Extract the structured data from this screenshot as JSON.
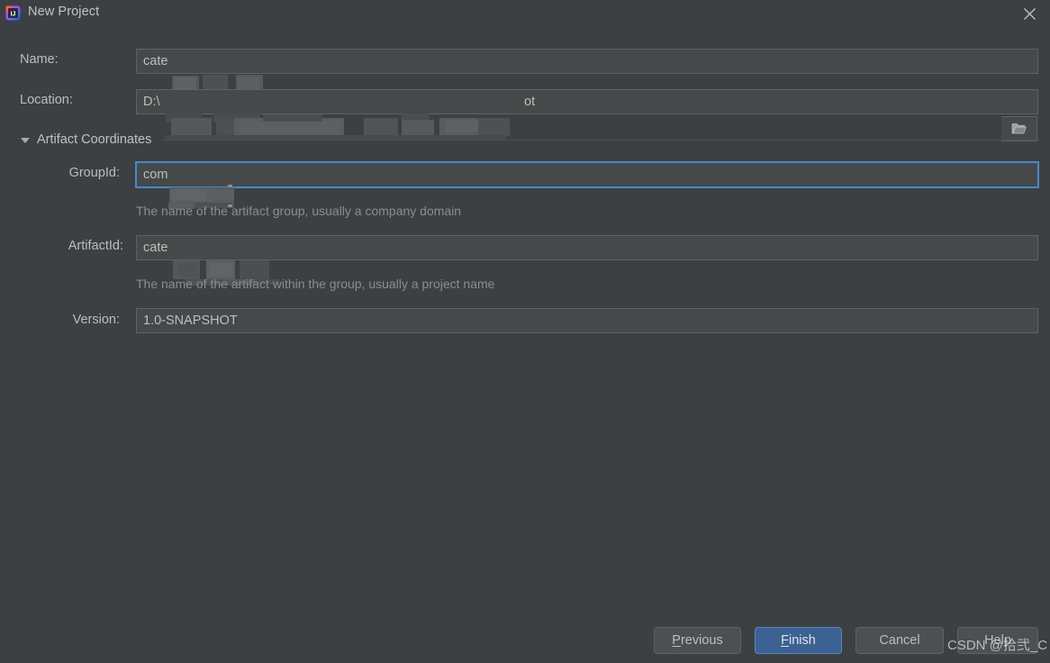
{
  "window": {
    "title": "New Project",
    "app_icon": "intellij-idea-icon",
    "close_icon": "close-icon",
    "background_color": "#3c4043"
  },
  "form": {
    "name": {
      "label": "Name:",
      "value": "cate",
      "redacted": true
    },
    "location": {
      "label": "Location:",
      "value": "D:\\",
      "value_tail": "ot",
      "redacted": true,
      "browse_icon": "folder-open-icon"
    }
  },
  "section": {
    "title": "Artifact Coordinates",
    "expanded": true,
    "twisty_icon": "chevron-down-icon",
    "fields": {
      "group_id": {
        "label": "GroupId:",
        "value": "com",
        "redacted": true,
        "focused": true,
        "hint": "The name of the artifact group, usually a company domain"
      },
      "artifact_id": {
        "label": "ArtifactId:",
        "value": "cate",
        "redacted": true,
        "focused": false,
        "hint": "The name of the artifact within the group, usually a project name"
      },
      "version": {
        "label": "Version:",
        "value": "1.0-SNAPSHOT",
        "redacted": false,
        "focused": false
      }
    }
  },
  "buttons": {
    "previous": {
      "label_prefix": "",
      "mnemonic": "P",
      "label_suffix": "revious",
      "primary": false
    },
    "finish": {
      "label_prefix": "",
      "mnemonic": "F",
      "label_suffix": "inish",
      "primary": true
    },
    "cancel": {
      "label": "Cancel",
      "primary": false
    },
    "help": {
      "label": "Help",
      "primary": false
    }
  },
  "watermark": {
    "text": "CSDN @拾弐_C"
  },
  "colors": {
    "accent": "#3c6293",
    "accent_border": "#5b86b9",
    "focus_border": "#4a88c7",
    "field_bg": "#45494a",
    "field_border": "#5e6264",
    "text": "#bdbebe",
    "hint_text": "#8a8d8e"
  }
}
